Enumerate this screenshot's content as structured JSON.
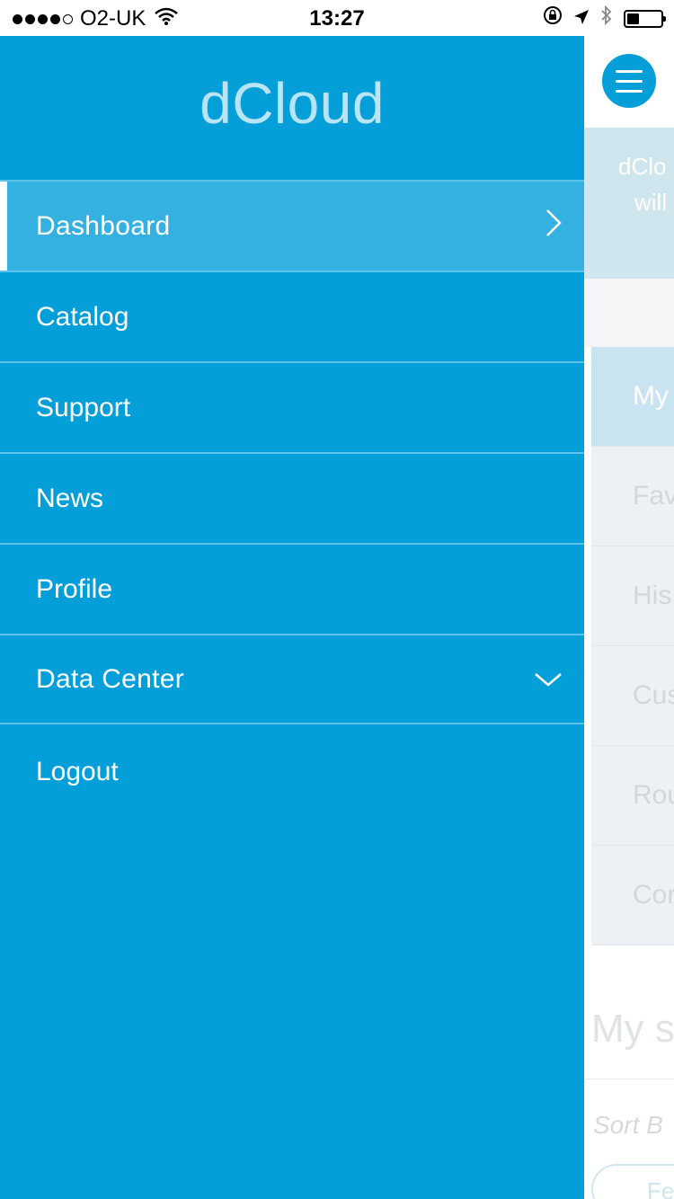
{
  "status_bar": {
    "signal_bars_filled": 4,
    "signal_bars_total": 5,
    "carrier": "O2-UK",
    "time": "13:27",
    "battery_level": 0.35,
    "icons": [
      "wifi-icon",
      "orientation-lock-icon",
      "location-arrow-icon",
      "bluetooth-icon",
      "battery-icon"
    ]
  },
  "drawer": {
    "brand": "dCloud",
    "items": [
      {
        "label": "Dashboard",
        "active": true,
        "icon": "chevron-right-icon"
      },
      {
        "label": "Catalog"
      },
      {
        "label": "Support"
      },
      {
        "label": "News"
      },
      {
        "label": "Profile"
      },
      {
        "label": "Data Center",
        "icon": "chevron-down-icon"
      }
    ],
    "logout": "Logout"
  },
  "background_page": {
    "banner_line1": "dClo",
    "banner_line2": "will",
    "list": [
      "My",
      "Fav",
      "His",
      "Cus",
      "Rou",
      "Cor"
    ],
    "heading": "My s",
    "sort": "Sort B",
    "pill": "Fe"
  },
  "colors": {
    "brand_blue": "#049fd9",
    "active_item": "#34b1e1",
    "divider": "#5cc4eb"
  }
}
